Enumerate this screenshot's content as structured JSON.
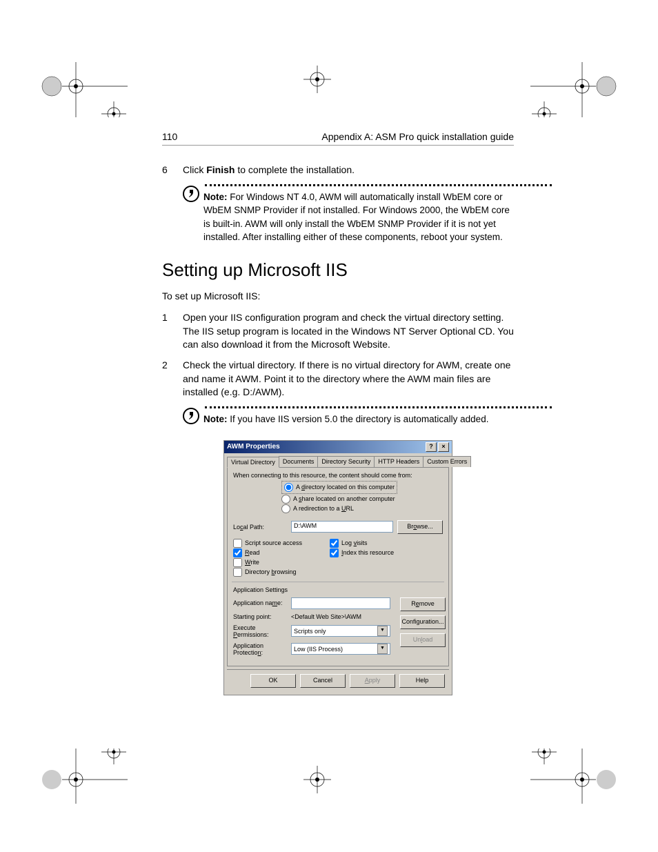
{
  "header": {
    "page_number": "110",
    "running_head": "Appendix A: ASM Pro quick installation guide"
  },
  "step6": {
    "num": "6",
    "prefix": "Click ",
    "bold": "Finish",
    "suffix": " to complete the installation."
  },
  "note1": {
    "label": "Note:",
    "text": " For Windows NT 4.0, AWM will automatically install WbEM core or WbEM SNMP Provider if not installed. For Windows 2000, the WbEM core is built-in. AWM will only install the WbEM SNMP Provider if it is not yet installed. After installing either of these components, reboot your system."
  },
  "section_title": "Setting up Microsoft IIS",
  "intro": "To set up Microsoft IIS:",
  "step1": {
    "num": "1",
    "text": "Open your IIS configuration program and check the virtual directory setting. The IIS setup program is located in the Windows NT Server Optional CD. You can also download it from the Microsoft Website."
  },
  "step2": {
    "num": "2",
    "text": "Check the virtual directory.  If there is no virtual directory for AWM, create one and name it AWM.  Point it to the directory where the AWM main files are installed (e.g. D:/AWM)."
  },
  "note2": {
    "label": "Note:",
    "text": " If you have IIS version 5.0 the directory is automatically added."
  },
  "dialog": {
    "title": "AWM Properties",
    "help_btn": "?",
    "close_btn": "×",
    "tabs": [
      "Virtual Directory",
      "Documents",
      "Directory Security",
      "HTTP Headers",
      "Custom Errors"
    ],
    "connect_label": "When connecting to this resource, the content should come from:",
    "radios": {
      "r1": "A directory located on this computer",
      "r2": "A share located on another computer",
      "r3": "A redirection to a URL"
    },
    "local_path_label": "Local Path:",
    "local_path_value": "D:\\AWM",
    "browse_btn": "Browse...",
    "perms_left": {
      "script_access": "Script source access",
      "read": "Read",
      "write": "Write",
      "dir_browsing": "Directory browsing"
    },
    "perms_right": {
      "log_visits": "Log visits",
      "index_resource": "Index this resource"
    },
    "app_settings_label": "Application Settings",
    "app_name_label": "Application name:",
    "app_name_value": "",
    "starting_point_label": "Starting point:",
    "starting_point_value": "<Default Web Site>\\AWM",
    "exec_perm_label": "Execute Permissions:",
    "exec_perm_value": "Scripts only",
    "app_prot_label": "Application Protection:",
    "app_prot_value": "Low (IIS Process)",
    "remove_btn": "Remove",
    "config_btn": "Configuration...",
    "unload_btn": "Unload",
    "ok": "OK",
    "cancel": "Cancel",
    "apply": "Apply",
    "help": "Help"
  }
}
